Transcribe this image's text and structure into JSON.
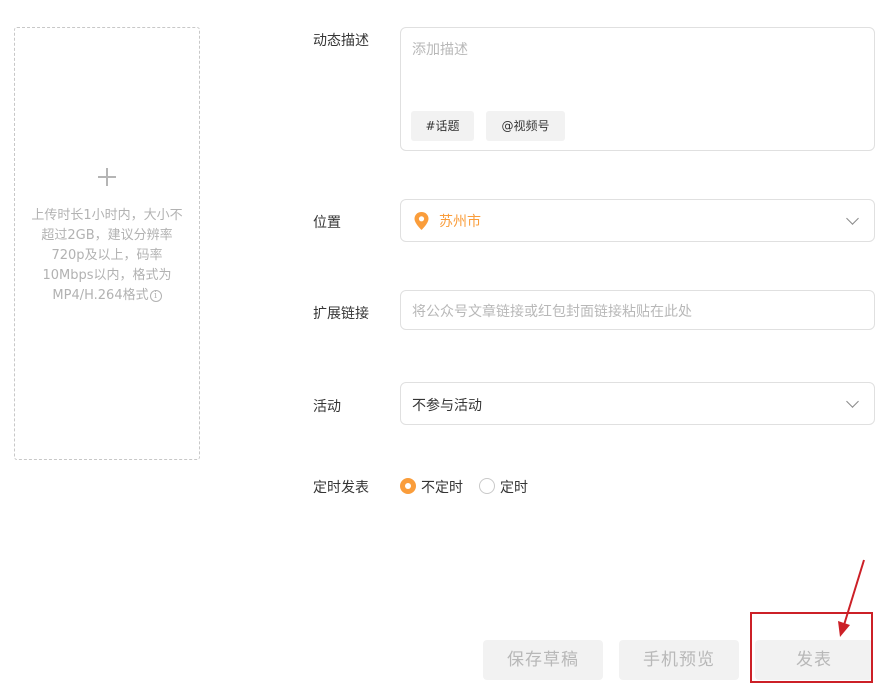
{
  "upload": {
    "hint": "上传时长1小时内，大小不超过2GB，建议分辨率720p及以上，码率10Mbps以内，格式为MP4/H.264格式",
    "info_icon_glyph": "i",
    "plus_icon": "plus-icon"
  },
  "description": {
    "label": "动态描述",
    "placeholder": "添加描述",
    "topic_tag": "#话题",
    "channel_tag": "@视频号"
  },
  "location": {
    "label": "位置",
    "value": "苏州市",
    "icon": "location-pin-icon",
    "accent_color": "#fa9d3b"
  },
  "extension_link": {
    "label": "扩展链接",
    "placeholder": "将公众号文章链接或红包封面链接粘贴在此处"
  },
  "activity": {
    "label": "活动",
    "value": "不参与活动"
  },
  "schedule": {
    "label": "定时发表",
    "options": [
      {
        "label": "不定时",
        "checked": true
      },
      {
        "label": "定时",
        "checked": false
      }
    ]
  },
  "actions": {
    "save_draft": "保存草稿",
    "phone_preview": "手机预览",
    "publish": "发表"
  },
  "annotation": {
    "color": "#cc2027"
  }
}
